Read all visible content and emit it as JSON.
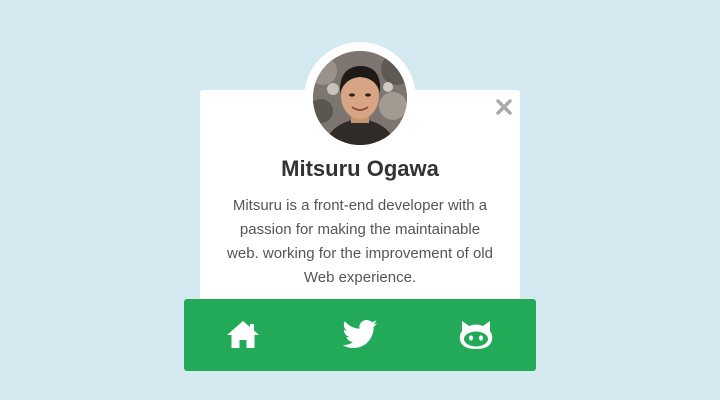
{
  "profile": {
    "name": "Mitsuru Ogawa",
    "bio": "Mitsuru is a front-end developer with a passion for making the maintainable web. working for the improvement of old Web experience."
  },
  "close_button": {
    "icon": "close-icon"
  },
  "social_links": [
    {
      "icon": "home-icon"
    },
    {
      "icon": "twitter-icon"
    },
    {
      "icon": "github-icon"
    }
  ],
  "colors": {
    "background": "#d5e9f1",
    "card": "#ffffff",
    "social_bar": "#22aa58",
    "name_text": "#333333",
    "bio_text": "#555555",
    "close_icon": "#aaaaaa"
  }
}
